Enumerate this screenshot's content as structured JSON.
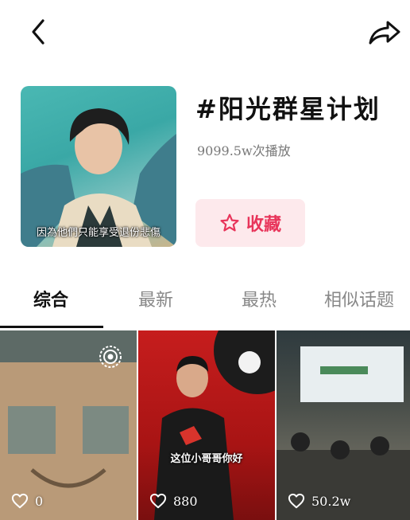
{
  "header": {
    "topic_title": "#阳光群星计划",
    "play_count": "9099.5w次播放",
    "favorite_label": "收藏",
    "cover_caption": "因為他們只能享受退份悲傷"
  },
  "tabs": [
    {
      "label": "综合"
    },
    {
      "label": "最新"
    },
    {
      "label": "最热"
    },
    {
      "label": "相似话题"
    }
  ],
  "videos": [
    {
      "likes": "0",
      "caption": ""
    },
    {
      "likes": "880",
      "caption": "这位小哥哥你好"
    },
    {
      "likes": "50.2w",
      "caption": ""
    }
  ],
  "colors": {
    "accent": "#e8345a",
    "favorite_bg": "#fde9ec",
    "inactive_tab": "#888888"
  },
  "icons": {
    "back": "chevron-left-icon",
    "share": "share-arrow-icon",
    "favorite": "star-outline-icon",
    "like": "heart-outline-icon",
    "live": "live-broadcast-icon"
  }
}
